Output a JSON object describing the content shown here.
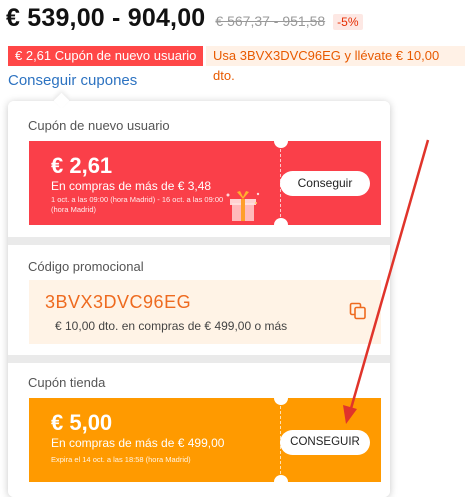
{
  "price": {
    "range": "€ 539,00 - 904,00",
    "original": "€ 567,37 - 951,58",
    "discount": "-5%"
  },
  "badges": {
    "coupon": "€ 2,61 Cupón de nuevo usuario",
    "promo": "Usa 3BVX3DVC96EG y llévate € 10,00 dto."
  },
  "get_coupons_link": "Conseguir cupones",
  "panel": {
    "new_user": {
      "title": "Cupón de nuevo usuario",
      "amount": "€ 2,61",
      "condition": "En compras de más de € 3,48",
      "validity": "1 oct. a las 09:00 (hora Madrid) - 16 oct. a las 09:00 (hora Madrid)",
      "button": "Conseguir"
    },
    "promo_code": {
      "title": "Código promocional",
      "code": "3BVX3DVC96EG",
      "description": "€ 10,00 dto. en compras de € 499,00 o más"
    },
    "store": {
      "title": "Cupón tienda",
      "amount": "€ 5,00",
      "condition": "En compras de más de € 499,00",
      "validity": "Expira el 14 oct. a las 18:58 (hora Madrid)",
      "button": "CONSEGUIR"
    }
  },
  "icons": {
    "copy": "copy-icon",
    "gift": "gift-icon"
  },
  "colors": {
    "coupon_red": "#fa3f49",
    "store_orange": "#ff9a00",
    "promo_text": "#ee6a1f",
    "link_blue": "#2d73c1",
    "annotation_arrow": "#e0342b"
  }
}
